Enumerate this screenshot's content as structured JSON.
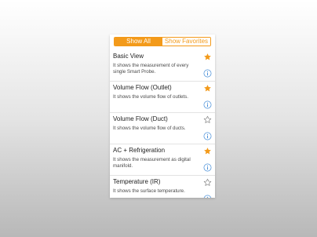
{
  "segmented": {
    "show_all": "Show All",
    "show_favorites": "Show Favorites",
    "active": "show_all"
  },
  "colors": {
    "accent": "#f39a1a",
    "info": "#4a90d9",
    "star_empty": "#888888"
  },
  "items": [
    {
      "title": "Basic View",
      "desc": "It shows the measurement of every single Smart Probe.",
      "favorite": true,
      "star_icon": "star-filled-icon",
      "info_icon": "info-icon"
    },
    {
      "title": "Volume Flow (Outlet)",
      "desc": "It shows the volume flow of outlets.",
      "favorite": true,
      "star_icon": "star-filled-icon",
      "info_icon": "info-icon"
    },
    {
      "title": "Volume Flow (Duct)",
      "desc": "It shows the volume flow of ducts.",
      "favorite": false,
      "star_icon": "star-outline-icon",
      "info_icon": "info-icon"
    },
    {
      "title": "AC + Refrigeration",
      "desc": "It shows the measurement as digital manifold.",
      "favorite": true,
      "star_icon": "star-filled-icon",
      "info_icon": "info-icon"
    },
    {
      "title": "Temperature (IR)",
      "desc": "It shows the surface temperature.",
      "favorite": false,
      "star_icon": "star-outline-icon",
      "info_icon": "info-icon"
    }
  ]
}
